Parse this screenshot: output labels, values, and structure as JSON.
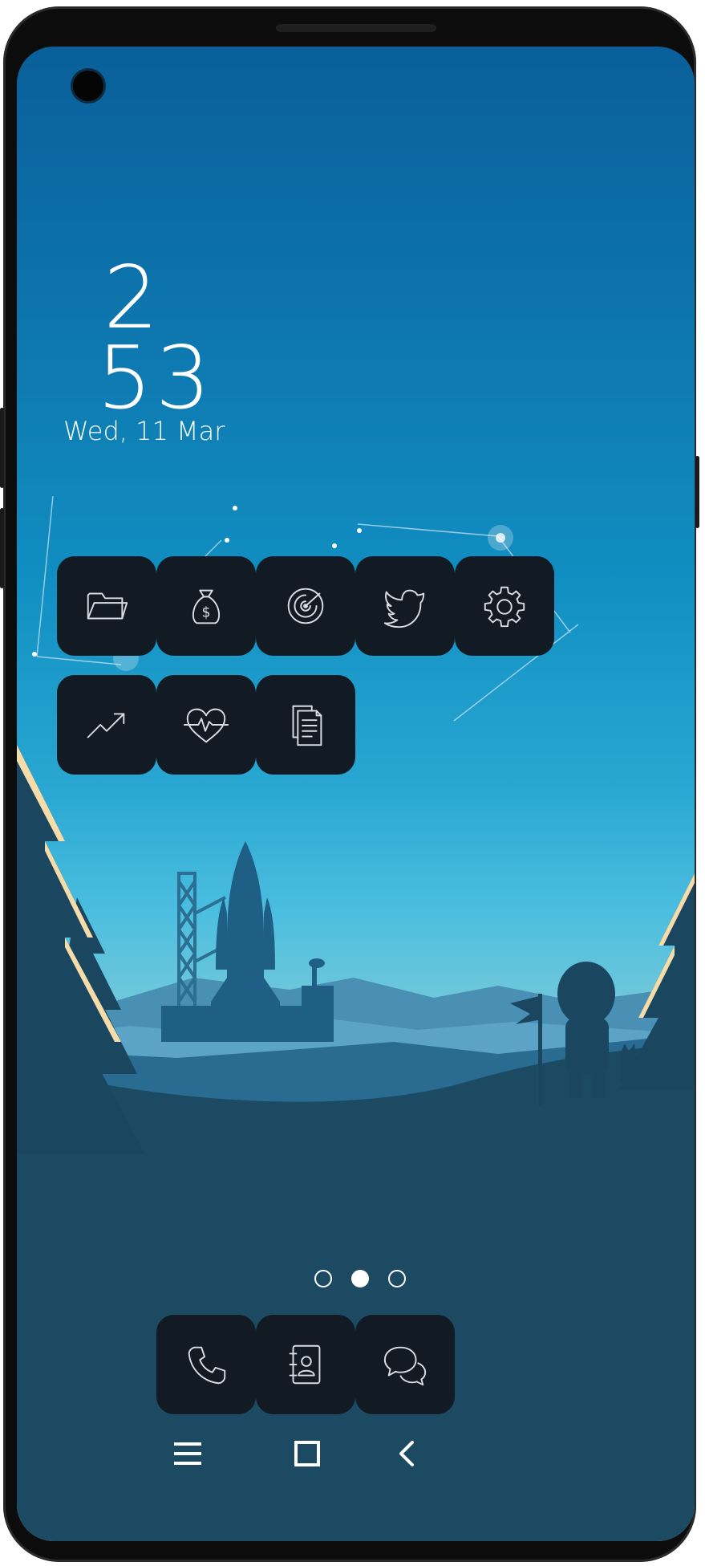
{
  "clock": {
    "hour": "2",
    "minute": "53",
    "date": "Wed, 11 Mar"
  },
  "icons": {
    "grid": [
      "folder-icon",
      "money-bag-icon",
      "radar-icon",
      "twitter-bird-icon",
      "settings-gear-icon",
      "trending-up-icon",
      "heartbeat-icon",
      "documents-icon"
    ],
    "dock": [
      "phone-icon",
      "contacts-icon",
      "chat-icon"
    ],
    "nav": [
      "menu-icon",
      "home-square-icon",
      "back-chevron-icon"
    ]
  },
  "page_indicator": {
    "pages": 3,
    "current": 2
  },
  "colors": {
    "icon_bg": "#121a24",
    "icon_stroke": "#d8dde2",
    "sky_top": "#0a5f99",
    "ground": "#1c4a63"
  }
}
